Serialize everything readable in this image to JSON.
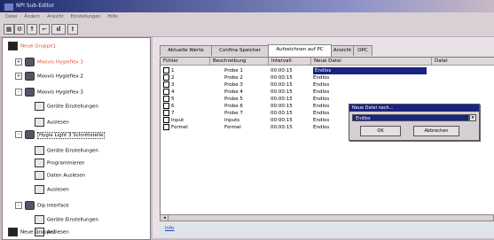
{
  "window": {
    "title": "NPI Sub-Editor"
  },
  "menu": [
    "Datei",
    "Ändern",
    "Ansicht",
    "Einstellungen",
    "Hilfe"
  ],
  "toolbar_icons": [
    "tool-icon-1",
    "tool-icon-2",
    "tool-icon-3",
    "tool-icon-4",
    "tool-icon-5"
  ],
  "tree": [
    {
      "label": "Neue Gruppe1",
      "color": "#e05030",
      "type": "stop"
    },
    {
      "label": "Moovis Hygieflex 3",
      "color": "#e05030",
      "type": "car",
      "expander": "+"
    },
    {
      "label": "Moovis Hygieflex 2",
      "color": "#000000",
      "type": "car",
      "expander": "+"
    },
    {
      "label": "Moovis Hygieflex 3",
      "color": "#000000",
      "type": "car",
      "expander": "-"
    },
    {
      "label": "Geräte Einstellungen",
      "color": "#000000",
      "type": "doc"
    },
    {
      "label": "Auslesen",
      "color": "#000000",
      "type": "doc"
    },
    {
      "label": "Hygie Light 3 Schnittstelle",
      "color": "#000000",
      "type": "car",
      "expander": "-",
      "selected": true
    },
    {
      "label": "Geräte Einstellungen",
      "color": "#000000",
      "type": "doc"
    },
    {
      "label": "Programmieren",
      "color": "#000000",
      "type": "doc"
    },
    {
      "label": "Daten Auslesen",
      "color": "#000000",
      "type": "doc"
    },
    {
      "label": "Auslesen",
      "color": "#000000",
      "type": "doc"
    },
    {
      "label": "Dip Interface",
      "color": "#000000",
      "type": "car",
      "expander": "-"
    },
    {
      "label": "Geräte Einstellungen",
      "color": "#000000",
      "type": "doc"
    },
    {
      "label": "Auslesen",
      "color": "#000000",
      "type": "doc"
    },
    {
      "label": "Neue Gruppe2",
      "color": "#000000",
      "type": "stop"
    }
  ],
  "tabs": [
    "Aktuelle Werte",
    "Confina Speicher",
    "Aufzeichnen auf PC",
    "Ansicht",
    "OPC"
  ],
  "active_tab": "Aufzeichnen auf PC",
  "table": {
    "headers": [
      "Fühler",
      "Beschreibung",
      "Intervall",
      "Neue Datei",
      "Datei"
    ],
    "rows": [
      {
        "sensor": "1",
        "desc": "Probe 1",
        "interval": "00:00:15",
        "file": "Endlos",
        "highlight": true
      },
      {
        "sensor": "2",
        "desc": "Probe 2",
        "interval": "00:00:15",
        "file": "Endlos"
      },
      {
        "sensor": "3",
        "desc": "Probe 3",
        "interval": "00:00:15",
        "file": "Endlos"
      },
      {
        "sensor": "4",
        "desc": "Probe 4",
        "interval": "00:00:15",
        "file": "Endlos"
      },
      {
        "sensor": "5",
        "desc": "Probe 5",
        "interval": "00:00:15",
        "file": "Endlos"
      },
      {
        "sensor": "6",
        "desc": "Probe 6",
        "interval": "00:00:15",
        "file": "Endlos"
      },
      {
        "sensor": "7",
        "desc": "Probe 7",
        "interval": "00:00:15",
        "file": "Endlos"
      },
      {
        "sensor": "Input",
        "desc": "Inputs",
        "interval": "00:00:15",
        "file": "Endlos"
      },
      {
        "sensor": "Formel",
        "desc": "Formel",
        "interval": "00:00:15",
        "file": "Endlos"
      }
    ]
  },
  "bottom": {
    "info_link": "Info"
  },
  "dialog": {
    "title": "Neue Datei nach...",
    "selected": "Endlos",
    "ok": "OK",
    "cancel": "Abbrechen"
  },
  "colors": {
    "selection": "#1a237e",
    "background": "#c8b9c4"
  }
}
